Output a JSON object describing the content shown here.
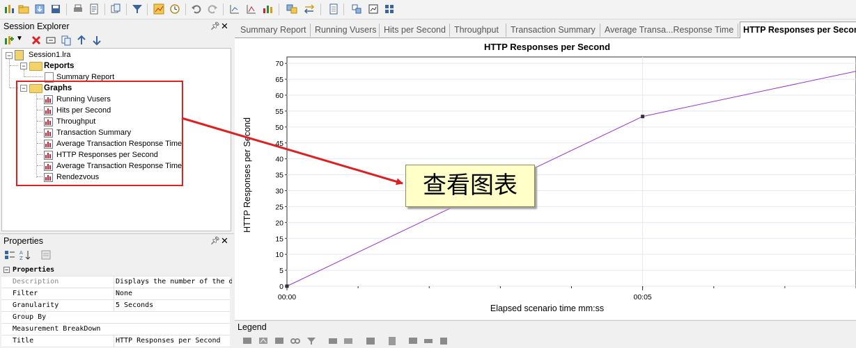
{
  "session_explorer": {
    "title": "Session Explorer",
    "tree": {
      "root": "Session1.lra",
      "reports_label": "Reports",
      "summary_report": "Summary Report",
      "graphs_label": "Graphs",
      "graphs": [
        "Running Vusers",
        "Hits per Second",
        "Throughput",
        "Transaction Summary",
        "Average Transaction Response Time",
        "HTTP Responses per Second",
        "Average Transaction Response Time",
        "Rendezvous"
      ]
    }
  },
  "properties": {
    "title": "Properties",
    "section": "Properties",
    "rows": [
      {
        "name": "Description",
        "value": "Displays the number of the d"
      },
      {
        "name": "Filter",
        "value": "None"
      },
      {
        "name": "Granularity",
        "value": "5 Seconds"
      },
      {
        "name": "Group By",
        "value": ""
      },
      {
        "name": "Measurement BreakDown",
        "value": ""
      },
      {
        "name": "Title",
        "value": "HTTP Responses per Second"
      }
    ]
  },
  "tabs": [
    "Summary Report",
    "Running Vusers",
    "Hits per Second",
    "Throughput",
    "Transaction Summary",
    "Average Transa...Response Time",
    "HTTP Responses per Secor"
  ],
  "legend": {
    "title": "Legend"
  },
  "annotation": {
    "text": "查看图表"
  },
  "colors": {
    "series": "#9933cc",
    "highlight": "#e02020",
    "callout_bg": "#ffffc8"
  },
  "chart_data": {
    "type": "line",
    "title": "HTTP Responses per Second",
    "xlabel": "Elapsed scenario time mm:ss",
    "ylabel": "HTTP Responses per Second",
    "x_ticks": [
      "00:00",
      "00:05"
    ],
    "y_ticks": [
      0,
      5,
      10,
      15,
      20,
      25,
      30,
      35,
      40,
      45,
      50,
      55,
      60,
      65,
      70
    ],
    "ylim": [
      0,
      72
    ],
    "xlim_seconds": [
      0,
      8
    ],
    "grid": true,
    "series": [
      {
        "points": [
          {
            "x": 0,
            "y": 0
          },
          {
            "x": 5,
            "y": 53.3
          },
          {
            "x": 8,
            "y": 67.5
          }
        ]
      }
    ]
  }
}
